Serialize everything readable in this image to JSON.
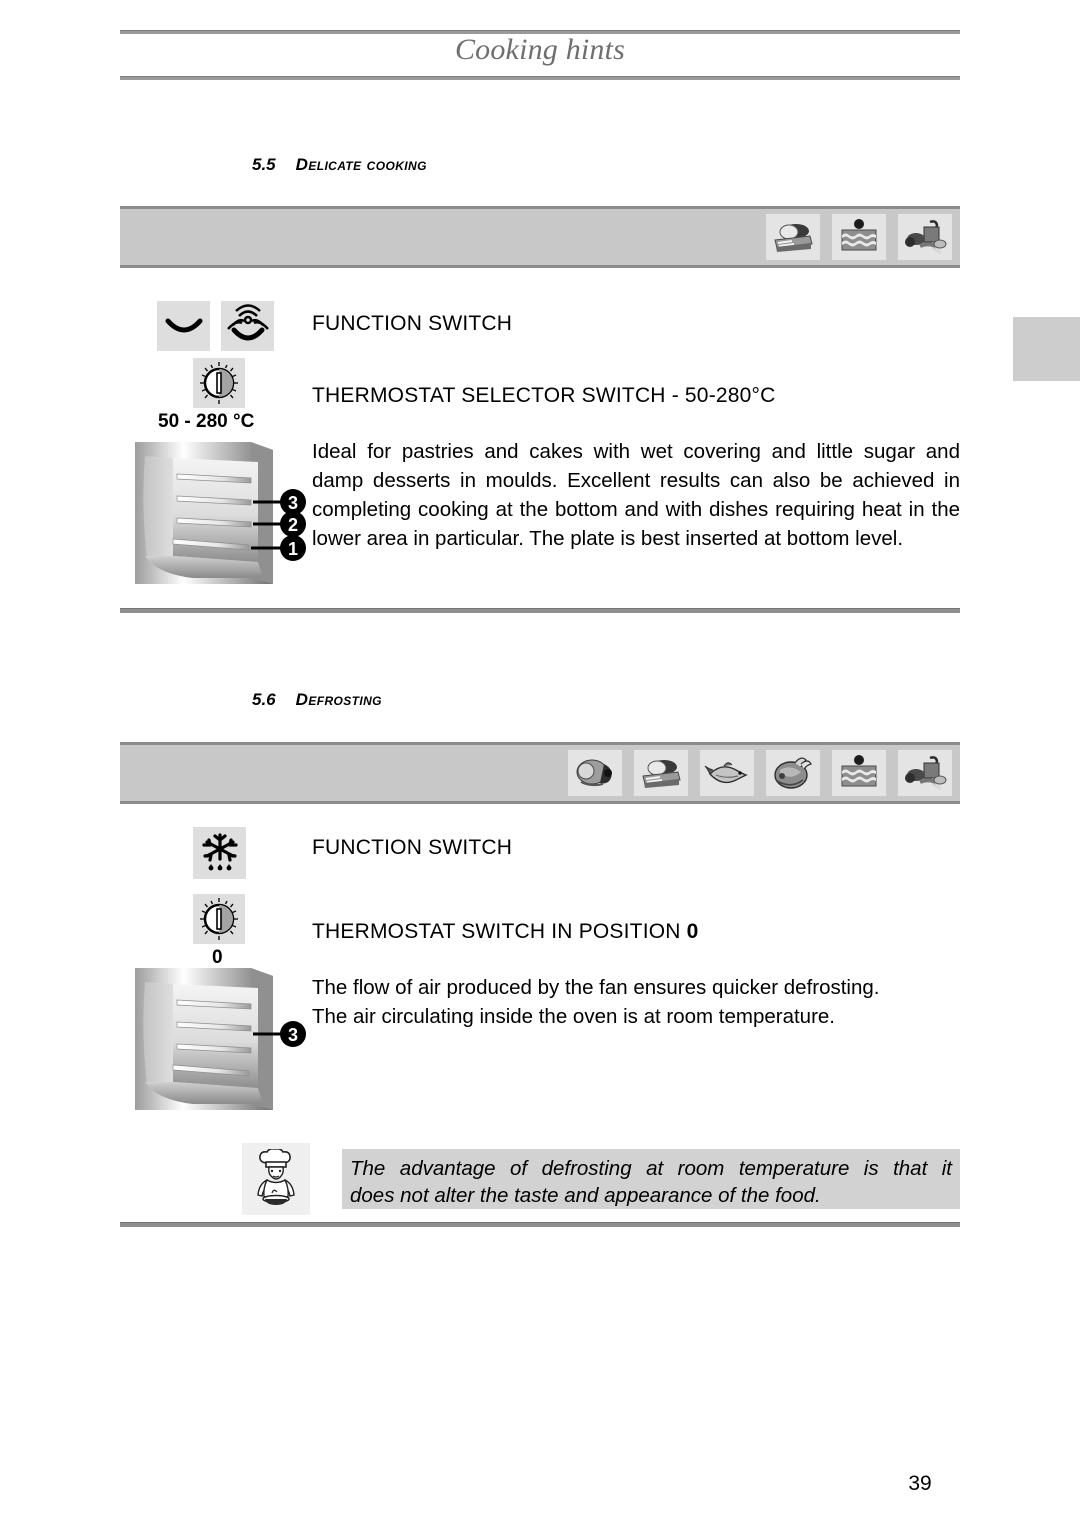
{
  "header": {
    "title": "Cooking hints"
  },
  "page_number": "39",
  "sections": [
    {
      "number": "5.5",
      "title": "Delicate cooking",
      "icon_bar": [
        {
          "name": "roast-meat-loaf-icon",
          "label": "roast meat loaf"
        },
        {
          "name": "cake-slice-icon",
          "label": "cake slice"
        },
        {
          "name": "vegetables-icon",
          "label": "vegetables"
        }
      ],
      "function_icons": [
        {
          "name": "bottom-heating-element-icon",
          "label": "bottom heating element"
        },
        {
          "name": "fan-assisted-bottom-heating-icon",
          "label": "fan assisted bottom heating"
        }
      ],
      "thermostat_icon": {
        "name": "thermostat-dial-icon",
        "label": "thermostat dial"
      },
      "thermostat_range_label": "50 - 280 °C",
      "function_switch_heading": "FUNCTION SWITCH",
      "thermostat_heading_plain": "THERMOSTAT SELECTOR SWITCH - 50-280°C",
      "body": "Ideal for pastries and cakes with wet covering and little sugar and damp desserts in moulds. Excellent results can also be achieved in completing cooking at the bottom and with dishes requiring heat in the lower area in particular. The plate is best inserted at bottom level.",
      "oven_levels": [
        "3",
        "2",
        "1"
      ]
    },
    {
      "number": "5.6",
      "title": "Defrosting",
      "icon_bar": [
        {
          "name": "ham-icon",
          "label": "ham"
        },
        {
          "name": "roast-meat-loaf-icon",
          "label": "roast meat loaf"
        },
        {
          "name": "fish-icon",
          "label": "fish"
        },
        {
          "name": "poultry-icon",
          "label": "poultry"
        },
        {
          "name": "cake-slice-icon",
          "label": "cake slice"
        },
        {
          "name": "vegetables-icon",
          "label": "vegetables"
        }
      ],
      "function_icons": [
        {
          "name": "defrost-snowflake-icon",
          "label": "defrost snowflake"
        }
      ],
      "thermostat_icon": {
        "name": "thermostat-dial-icon",
        "label": "thermostat dial"
      },
      "thermostat_position_label": "0",
      "function_switch_heading": "FUNCTION SWITCH",
      "thermostat_heading_prefix": "THERMOSTAT SWITCH IN POSITION ",
      "thermostat_heading_value": "0",
      "body_line_1": "The flow of air produced by the fan ensures quicker defrosting.",
      "body_line_2": "The air circulating inside the oven is at room temperature.",
      "oven_levels": [
        "3"
      ],
      "note": {
        "icon": {
          "name": "chef-tip-icon",
          "label": "chef tip"
        },
        "line_1": "The advantage of defrosting at room temperature is that it",
        "line_2": "does not alter the taste and appearance of the food."
      }
    }
  ],
  "colors": {
    "rule_gray": "#8f8f8f",
    "band_gray": "#c8c8c8",
    "note_gray": "#d2d2d2",
    "header_text": "#6e6e6e",
    "side_tab": "#cdcdcd"
  }
}
